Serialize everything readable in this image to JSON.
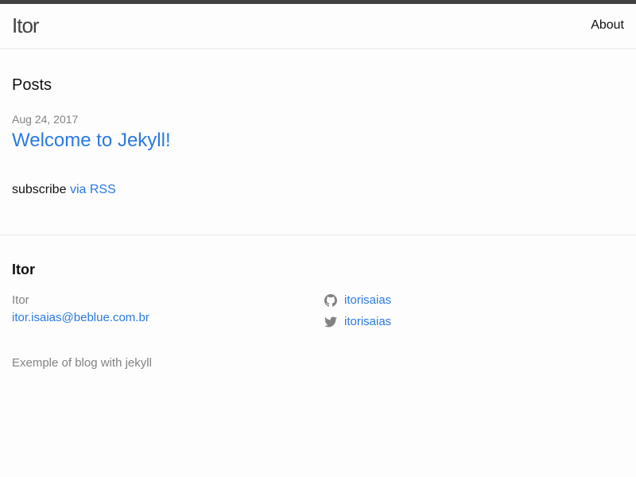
{
  "header": {
    "site_title": "Itor",
    "nav": {
      "about": "About"
    }
  },
  "posts": {
    "heading": "Posts",
    "items": [
      {
        "date": "Aug 24, 2017",
        "title": "Welcome to Jekyll!"
      }
    ],
    "subscribe_text": "subscribe",
    "rss_link": "via RSS"
  },
  "footer": {
    "heading": "Itor",
    "name": "Itor",
    "email": "itor.isaias@beblue.com.br",
    "github": {
      "icon": "github-icon",
      "username": "itorisaias"
    },
    "twitter": {
      "icon": "twitter-icon",
      "username": "itorisaias"
    },
    "description": "Exemple of blog with jekyll"
  },
  "colors": {
    "link": "#2a7ae2",
    "text": "#111111",
    "muted": "#828282",
    "topbar": "#424242",
    "background": "#fdfdfd"
  }
}
